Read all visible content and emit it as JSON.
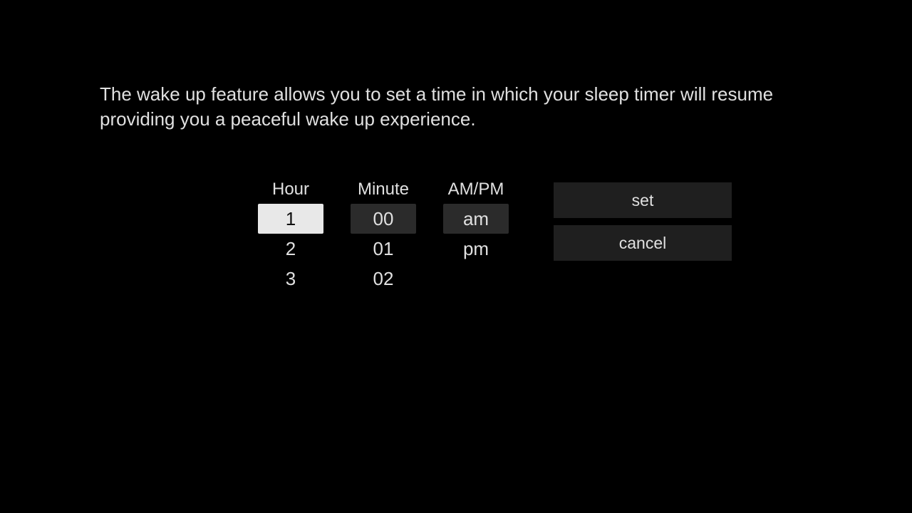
{
  "description": "The wake up feature allows you to set a time in which your sleep timer will resume providing you a peaceful wake up experience.",
  "picker": {
    "hour": {
      "label": "Hour",
      "items": [
        "1",
        "2",
        "3"
      ],
      "selected": "1",
      "focused": true
    },
    "minute": {
      "label": "Minute",
      "items": [
        "00",
        "01",
        "02"
      ],
      "selected": "00",
      "focused": false
    },
    "ampm": {
      "label": "AM/PM",
      "items": [
        "am",
        "pm"
      ],
      "selected": "am",
      "focused": false
    }
  },
  "buttons": {
    "set": "set",
    "cancel": "cancel"
  }
}
